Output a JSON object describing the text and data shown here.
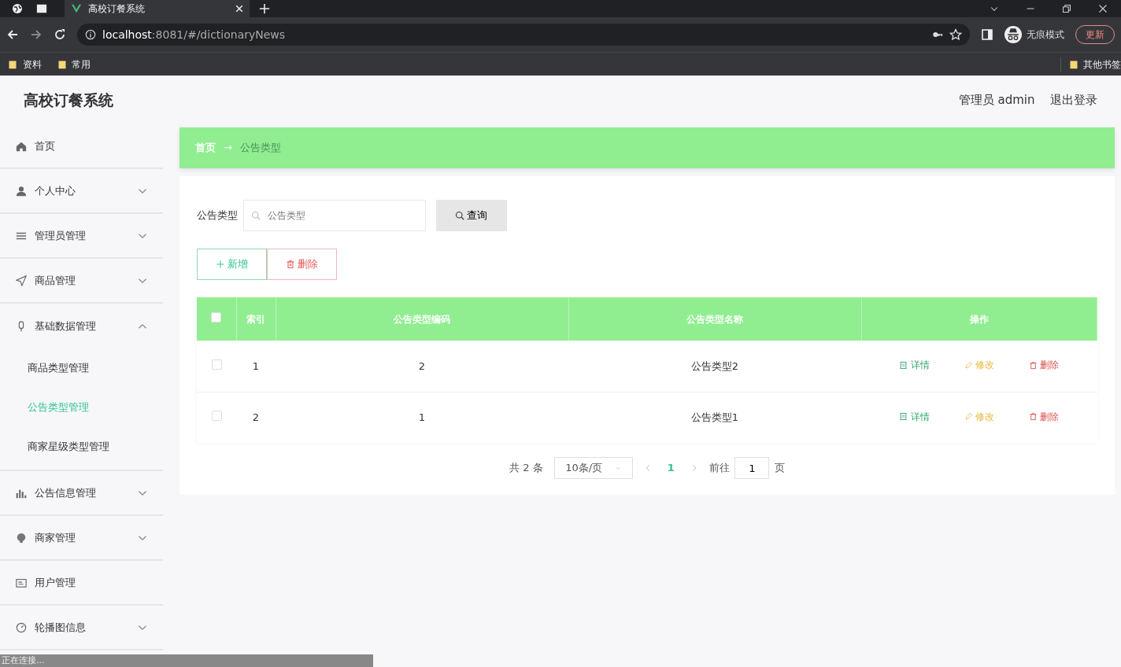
{
  "browser": {
    "tab_title": "高校订餐系统",
    "url_host": "localhost",
    "url_rest": ":8081/#/dictionaryNews",
    "profile": "无痕模式",
    "update_button": "更新",
    "bookmarks": [
      "资料",
      "常用"
    ],
    "other_bookmarks": "其他书签"
  },
  "header": {
    "title": "高校订餐系统",
    "user": "管理员 admin",
    "logout": "退出登录"
  },
  "sidebar": {
    "items": [
      {
        "kind": "link",
        "label": "首页"
      },
      {
        "kind": "group",
        "label": "个人中心",
        "expanded": false
      },
      {
        "kind": "group",
        "label": "管理员管理",
        "expanded": false
      },
      {
        "kind": "group",
        "label": "商品管理",
        "expanded": false
      },
      {
        "kind": "group",
        "label": "基础数据管理",
        "expanded": true,
        "children": [
          {
            "label": "商品类型管理",
            "selected": false
          },
          {
            "label": "公告类型管理",
            "selected": true
          },
          {
            "label": "商家星级类型管理",
            "selected": false
          }
        ]
      },
      {
        "kind": "group",
        "label": "公告信息管理",
        "expanded": false
      },
      {
        "kind": "group",
        "label": "商家管理",
        "expanded": false
      },
      {
        "kind": "link",
        "label": "用户管理"
      },
      {
        "kind": "group",
        "label": "轮播图信息",
        "expanded": false
      }
    ]
  },
  "breadcrumb": [
    "首页",
    "→",
    "公告类型"
  ],
  "search": {
    "label": "公告类型",
    "placeholder": "公告类型",
    "button": "查询"
  },
  "actions": [
    {
      "kind": "add",
      "label": "新增"
    },
    {
      "kind": "delete",
      "label": "删除"
    }
  ],
  "table": {
    "all_checked": false,
    "columns": [
      "索引",
      "公告类型编码",
      "公告类型名称",
      "操作"
    ],
    "rows": [
      {
        "checked": false,
        "index": "1",
        "code": "2",
        "name": "公告类型2",
        "ops": [
          {
            "kind": "detail",
            "label": "详情"
          },
          {
            "kind": "edit",
            "label": "修改"
          },
          {
            "kind": "delete",
            "label": "删除"
          }
        ]
      },
      {
        "checked": false,
        "index": "2",
        "code": "1",
        "name": "公告类型1",
        "ops": [
          {
            "kind": "detail",
            "label": "详情"
          },
          {
            "kind": "edit",
            "label": "修改"
          },
          {
            "kind": "delete",
            "label": "删除"
          }
        ]
      }
    ]
  },
  "pagination": {
    "total": "共 2 条",
    "page_size": "10条/页",
    "pages": [
      {
        "label": "1",
        "selected": true
      }
    ],
    "goto_label": "前往",
    "goto_value": "1",
    "goto_suffix": "页"
  },
  "status_bar": "正在连接..."
}
